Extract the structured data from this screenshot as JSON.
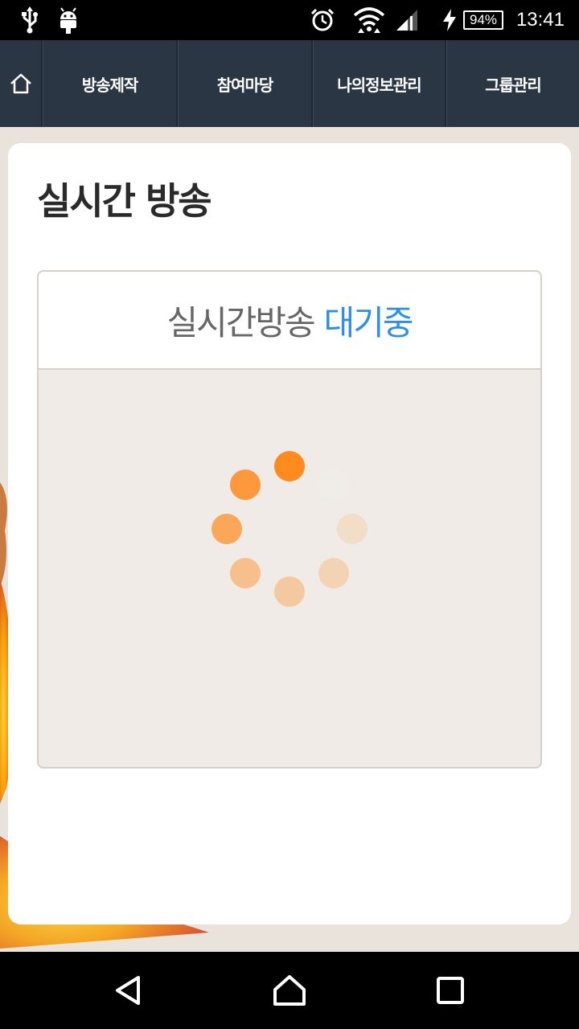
{
  "status_bar": {
    "time": "13:41",
    "battery": "94%",
    "icons": [
      "usb-icon",
      "android-debug-icon",
      "alarm-icon",
      "wifi-icon",
      "signal-icon",
      "charging-icon"
    ]
  },
  "top_nav": {
    "home_icon": "home-icon",
    "tabs": [
      {
        "label": "방송제작"
      },
      {
        "label": "참여마당"
      },
      {
        "label": "나의정보관리"
      },
      {
        "label": "그룹관리"
      }
    ]
  },
  "page": {
    "title": "실시간 방송"
  },
  "live": {
    "status_prefix": "실시간방송",
    "status_value": "대기중",
    "accent_color": "#2f8fe8",
    "spinner_color": "#ff8a1e"
  },
  "system_nav": {
    "icons": [
      "back-icon",
      "home-icon",
      "recents-icon"
    ]
  }
}
